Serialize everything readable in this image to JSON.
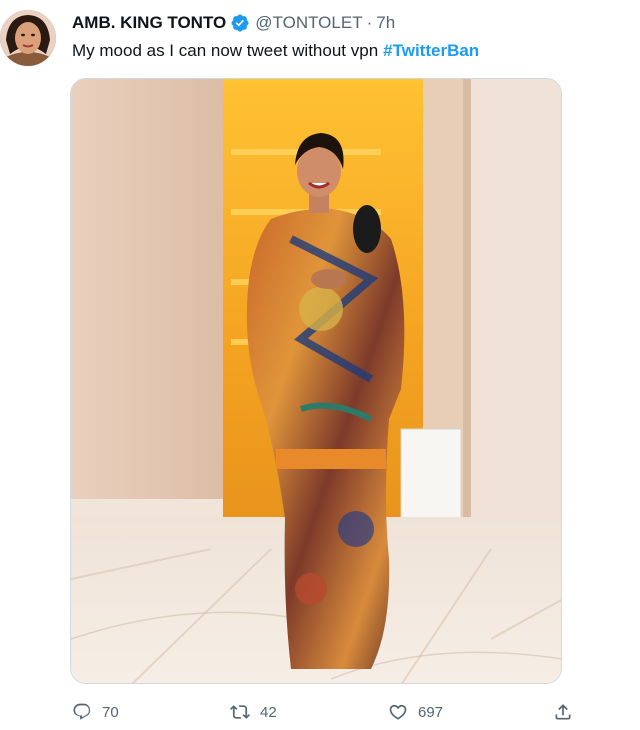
{
  "tweet": {
    "author_name": "AMB. KING TONTO",
    "handle": "@TONTOLET",
    "separator": "·",
    "time": "7h",
    "text": "My mood as I can now tweet without vpn",
    "hashtag": "#TwitterBan"
  },
  "actions": {
    "reply_count": "70",
    "retweet_count": "42",
    "like_count": "697"
  },
  "colors": {
    "link": "#1d9bf0",
    "secondary_text": "#536471",
    "primary_text": "#0f1419",
    "verified": "#1d9bf0"
  },
  "icons": [
    "verified-badge-icon",
    "reply-icon",
    "retweet-icon",
    "like-icon",
    "share-icon"
  ]
}
